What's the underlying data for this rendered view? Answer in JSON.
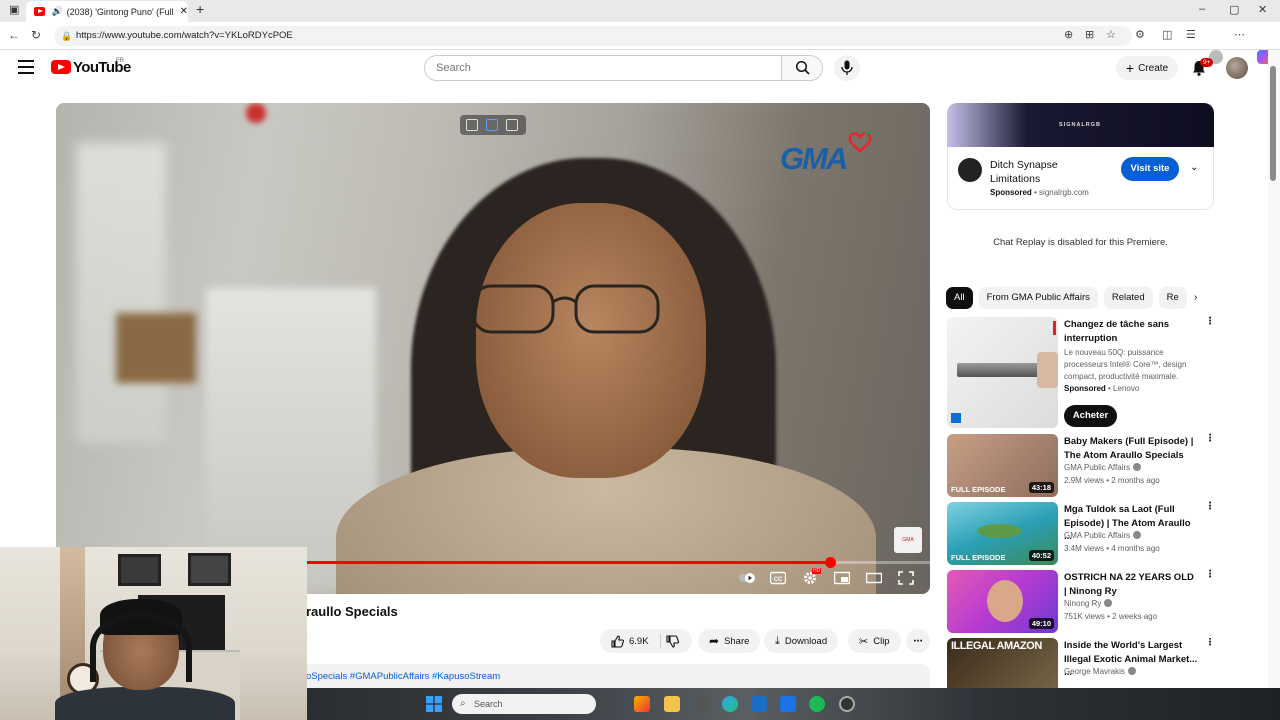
{
  "browser": {
    "tab_title": "(2038) 'Gintong Puno' (Full E",
    "url": "https://www.youtube.com/watch?v=YKLoRDYcPOE"
  },
  "header": {
    "logo_text": "YouTube",
    "region": "FR",
    "search_placeholder": "Search",
    "create_label": "Create",
    "notif_count": "9+"
  },
  "video": {
    "title_fragment": "raullo Specials",
    "watermark": "GMA",
    "progress_fraction": 0.886,
    "likes": "6.9K",
    "share_label": "Share",
    "download_label": "Download",
    "clip_label": "Clip",
    "hashtags": "oSpecials #GMAPublicAffairs #KapusoStream"
  },
  "sidebar_ad": {
    "banner_text": "SIGNALRGB",
    "title": "Ditch Synapse Limitations",
    "sponsored_label": "Sponsored",
    "domain": "signalrgb.com",
    "cta": "Visit site"
  },
  "chat_replay": "Chat Replay is disabled for this Premiere.",
  "chips": [
    "All",
    "From GMA Public Affairs",
    "Related",
    "Re"
  ],
  "ad_rec": {
    "title": "Changez de tâche sans interruption",
    "desc": "Le nouveau 50Q: puissance processeurs Intel® Core™, design compact, productivité maximale.",
    "sponsored_label": "Sponsored",
    "advertiser": "Lenovo",
    "cta": "Acheter"
  },
  "recommendations": [
    {
      "title": "Baby Makers (Full Episode) | The Atom Araullo Specials",
      "channel": "GMA Public Affairs",
      "meta": "2.9M views • 2 months ago",
      "duration": "43:18",
      "badge": "FULL EPISODE"
    },
    {
      "title": "Mga Tuldok sa Laot (Full Episode) | The Atom Araullo ...",
      "channel": "GMA Public Affairs",
      "meta": "3.4M views • 4 months ago",
      "duration": "40:52",
      "badge": "FULL EPISODE"
    },
    {
      "title": "OSTRICH NA 22 YEARS OLD | Ninong Ry",
      "channel": "Ninong Ry",
      "meta": "751K views • 2 weeks ago",
      "duration": "49:10",
      "badge": ""
    },
    {
      "title": "Inside the World's Largest Illegal Exotic Animal Market... ...",
      "channel": "George Mavrakis",
      "meta": "",
      "duration": "",
      "badge": "ILLEGAL AMAZON"
    }
  ],
  "taskbar": {
    "search_placeholder": "Search"
  }
}
